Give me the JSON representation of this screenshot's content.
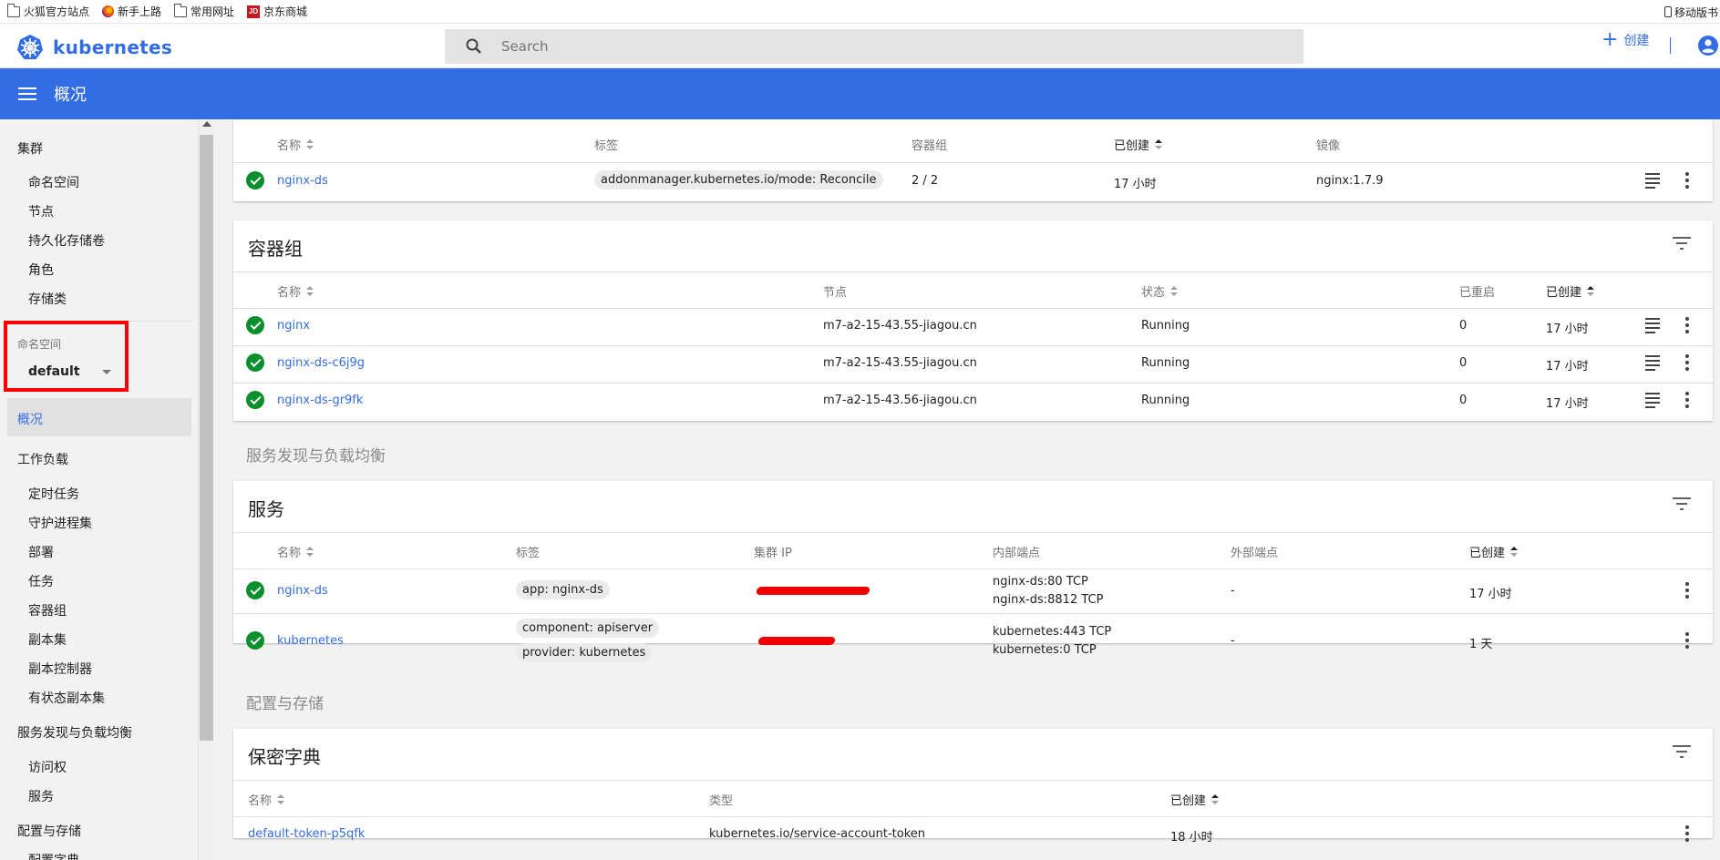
{
  "bookmarks": {
    "items": [
      {
        "label": "火狐官方站点",
        "icon": "folder-icon"
      },
      {
        "label": "新手上路",
        "icon": "firefox-icon"
      },
      {
        "label": "常用网址",
        "icon": "folder-icon"
      },
      {
        "label": "京东商城",
        "icon": "jd-icon"
      }
    ],
    "jd_badge": "JD",
    "right_label": "移动版书"
  },
  "app": {
    "logo_text": "kubernetes",
    "search_placeholder": "Search",
    "create_label": "创建",
    "page_title": "概况",
    "accent": "#326de6"
  },
  "sidebar": {
    "cluster_heading": "集群",
    "cluster_items": [
      "命名空间",
      "节点",
      "持久化存储卷",
      "角色",
      "存储类"
    ],
    "namespace_label": "命名空间",
    "namespace_value": "default",
    "overview": "概况",
    "workloads_heading": "工作负载",
    "workload_items": [
      "定时任务",
      "守护进程集",
      "部署",
      "任务",
      "容器组",
      "副本集",
      "副本控制器",
      "有状态副本集"
    ],
    "discovery_heading": "服务发现与负载均衡",
    "discovery_items": [
      "访问权",
      "服务"
    ],
    "config_heading": "配置与存储",
    "config_items_partial": [
      "配置字典"
    ]
  },
  "daemonsets": {
    "headers": {
      "name": "名称",
      "labels": "标签",
      "pods": "容器组",
      "created": "已创建",
      "images": "镜像"
    },
    "rows": [
      {
        "name": "nginx-ds",
        "label": "addonmanager.kubernetes.io/mode: Reconcile",
        "pods": "2 / 2",
        "created": "17 小时",
        "image": "nginx:1.7.9"
      }
    ]
  },
  "pods": {
    "title": "容器组",
    "headers": {
      "name": "名称",
      "node": "节点",
      "status": "状态",
      "restarts": "已重启",
      "created": "已创建"
    },
    "rows": [
      {
        "name": "nginx",
        "node": "m7-a2-15-43.55-jiagou.cn",
        "status": "Running",
        "restarts": "0",
        "created": "17 小时"
      },
      {
        "name": "nginx-ds-c6j9g",
        "node": "m7-a2-15-43.55-jiagou.cn",
        "status": "Running",
        "restarts": "0",
        "created": "17 小时"
      },
      {
        "name": "nginx-ds-gr9fk",
        "node": "m7-a2-15-43.56-jiagou.cn",
        "status": "Running",
        "restarts": "0",
        "created": "17 小时"
      }
    ]
  },
  "discovery_section": "服务发现与负载均衡",
  "services": {
    "title": "服务",
    "headers": {
      "name": "名称",
      "labels": "标签",
      "cluster_ip": "集群 IP",
      "internal": "内部端点",
      "external": "外部端点",
      "created": "已创建"
    },
    "rows": [
      {
        "name": "nginx-ds",
        "labels": [
          "app: nginx-ds"
        ],
        "internal": [
          "nginx-ds:80 TCP",
          "nginx-ds:8812 TCP"
        ],
        "external": "-",
        "created": "17 小时"
      },
      {
        "name": "kubernetes",
        "labels": [
          "component: apiserver",
          "provider: kubernetes"
        ],
        "internal": [
          "kubernetes:443 TCP",
          "kubernetes:0 TCP"
        ],
        "external": "-",
        "created": "1 天"
      }
    ]
  },
  "config_section": "配置与存储",
  "secrets": {
    "title": "保密字典",
    "headers": {
      "name": "名称",
      "type": "类型",
      "created": "已创建"
    },
    "rows": [
      {
        "name": "default-token-p5qfk",
        "type": "kubernetes.io/service-account-token",
        "created": "18 小时"
      }
    ]
  }
}
